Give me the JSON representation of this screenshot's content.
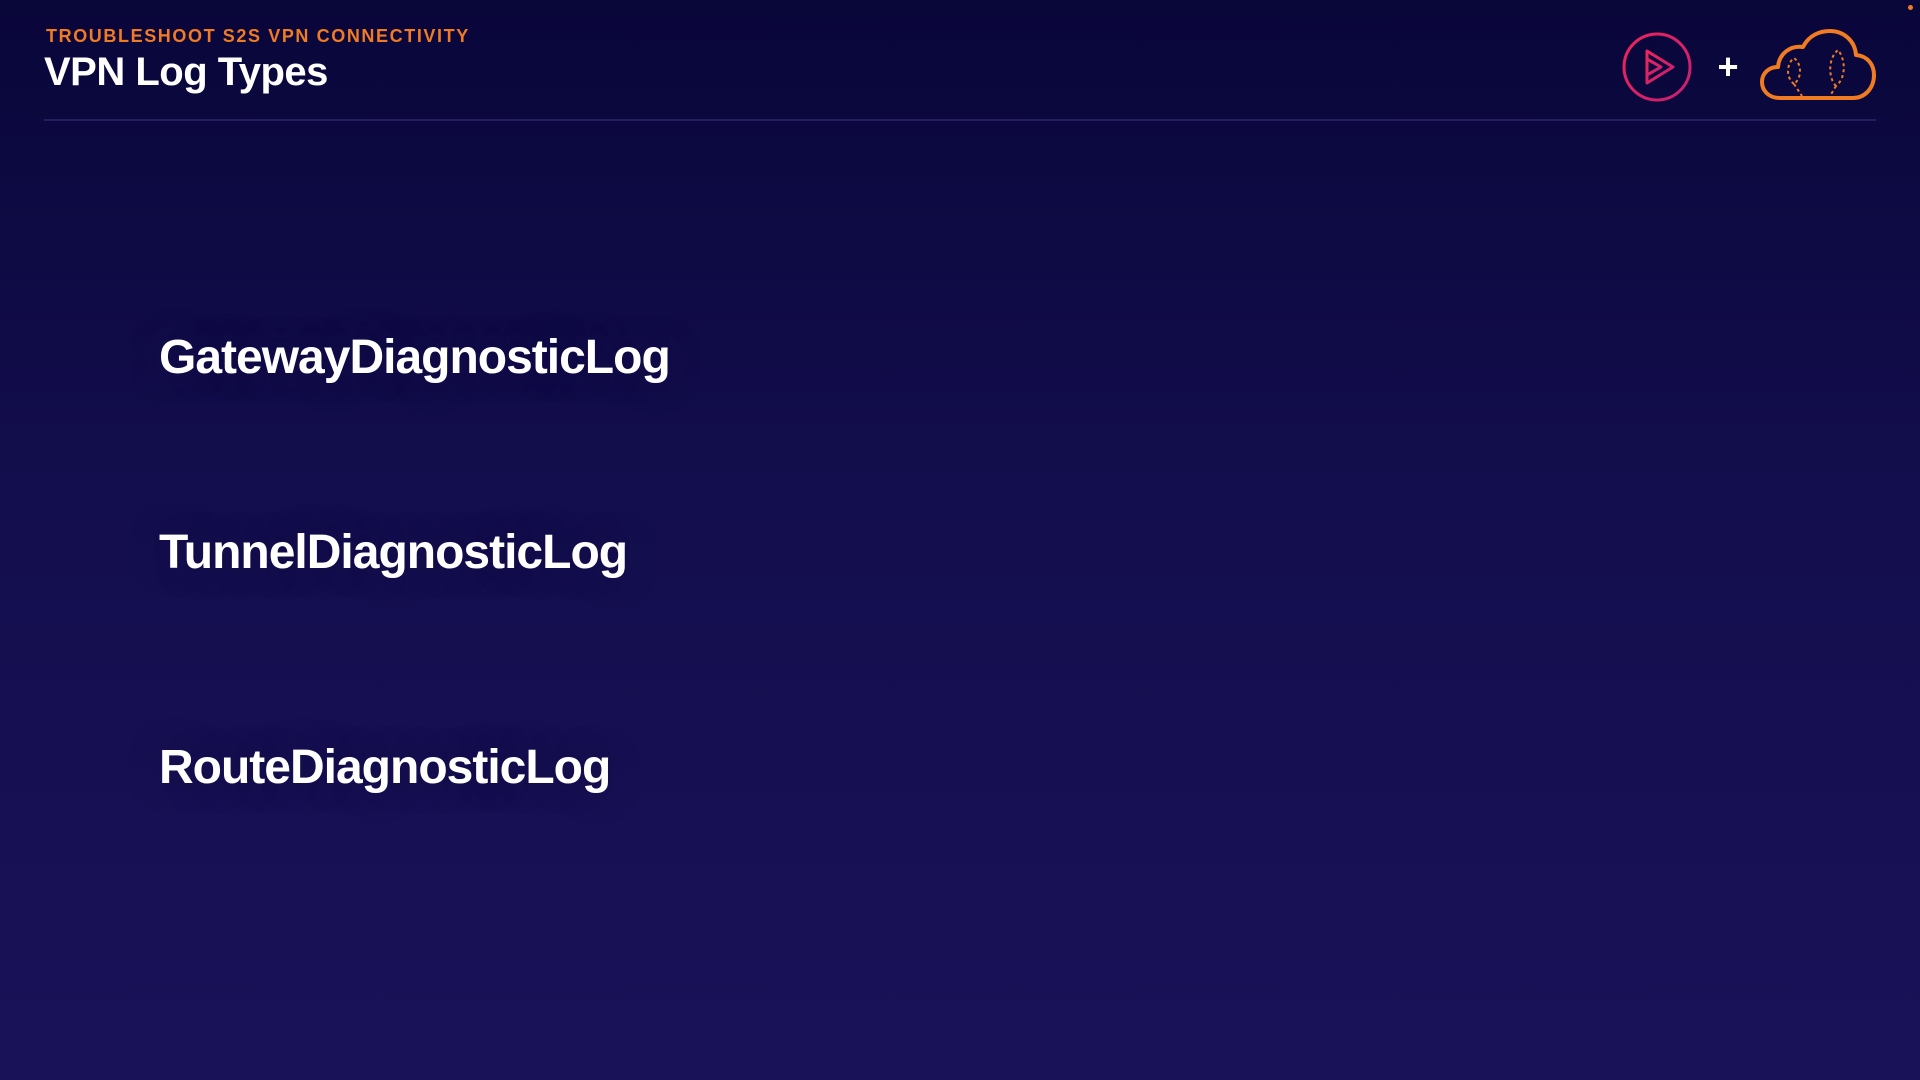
{
  "header": {
    "subtitle": "TROUBLESHOOT S2S VPN CONNECTIVITY",
    "title": "VPN Log Types",
    "plus": "+"
  },
  "branding": {
    "left_logo": "play-triangle-circle-icon",
    "right_logo": "cloud-icon",
    "left_logo_color": "#e0245e",
    "right_logo_color": "#f07b22",
    "accent_color": "#f07b22"
  },
  "log_types": [
    "GatewayDiagnosticLog",
    "TunnelDiagnosticLog",
    "RouteDiagnosticLog"
  ]
}
